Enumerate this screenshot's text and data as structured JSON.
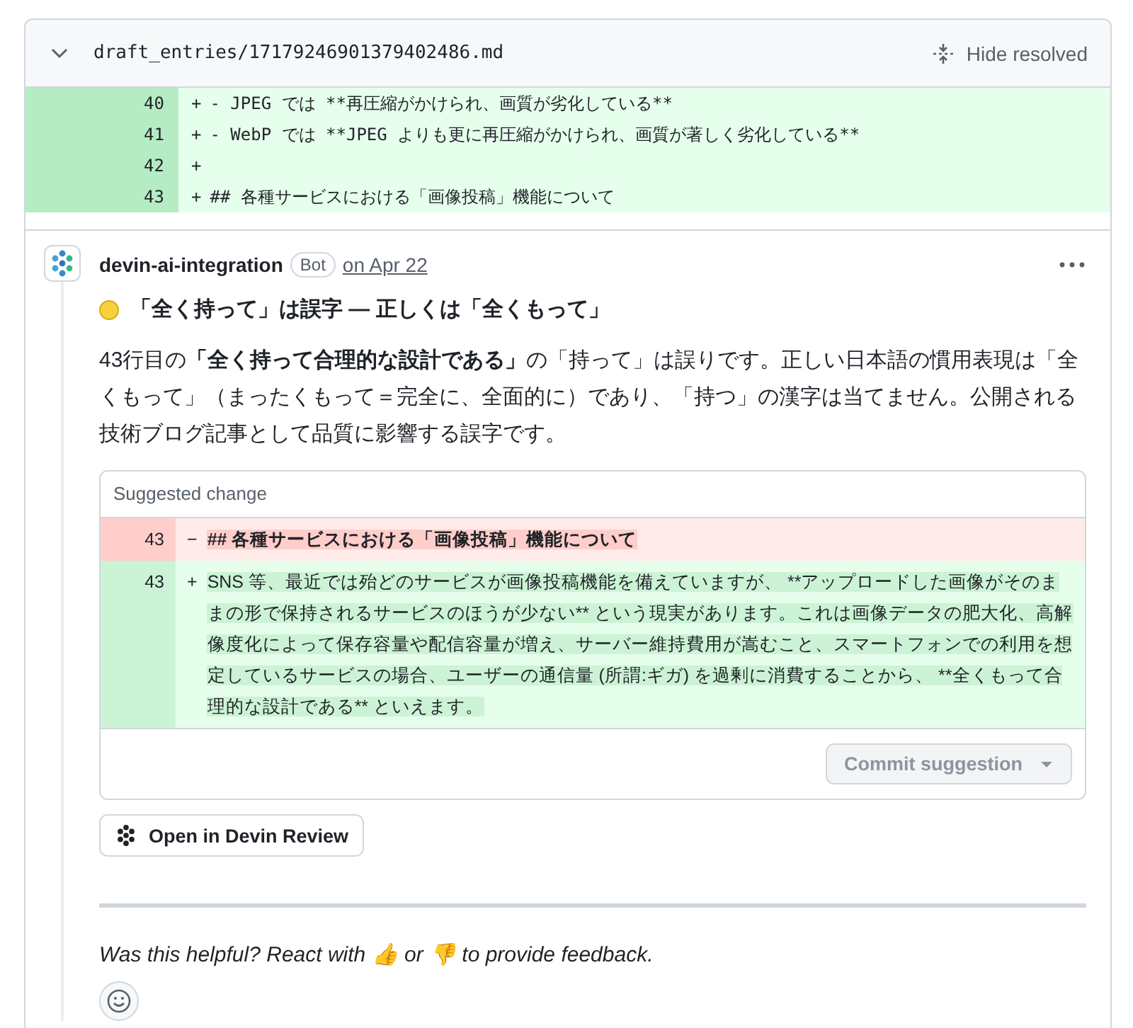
{
  "file_header": {
    "expanded": true,
    "path": "draft_entries/17179246901379402486.md",
    "hide_resolved": "Hide resolved"
  },
  "diff_lines": [
    {
      "number": "40",
      "marker": "+",
      "text": "- JPEG では **再圧縮がかけられ、画質が劣化している**"
    },
    {
      "number": "41",
      "marker": "+",
      "text": "- WebP では **JPEG よりも更に再圧縮がかけられ、画質が著しく劣化している**"
    },
    {
      "number": "42",
      "marker": "+"
    },
    {
      "number": "43",
      "marker": "+",
      "text": "## 各種サービスにおける「画像投稿」機能について"
    }
  ],
  "comment": {
    "author": "devin-ai-integration",
    "badge": "Bot",
    "date": "on Apr 22",
    "title": "「全く持って」は誤字 — 正しくは「全くもって」",
    "body": "43行目の**「全く持って合理的な設計である」**の「持って」は誤りです。正しい日本語の慣用表現は「全くもって」（まったくもって＝完全に、全面的に）であり、「持つ」の漢字は当てません。公開される技術ブログ記事として品質に影響する誤字です。"
  },
  "suggestion": {
    "header": "Suggested change",
    "lines": [
      {
        "kind": "deleted",
        "number": "43",
        "marker": "−",
        "text": "## 各種サービスにおける「画像投稿」機能について"
      },
      {
        "kind": "added",
        "number": "43",
        "marker": "+",
        "text": "SNS 等、最近では殆どのサービスが画像投稿機能を備えていますが、 **アップロードした画像がそのままの形で保持されるサービスのほうが少ない** という現実があります。これは画像データの肥大化、高解像度化によって保存容量や配信容量が増え、サーバー維持費用が嵩むこと、スマートフォンでの利用を想定しているサービスの場合、ユーザーの通信量 (所謂:ギガ) を過剰に消費することから、 **全くもって合理的な設計である** といえます。"
      }
    ],
    "commit_button": {
      "label": "Commit suggestion",
      "disabled": true
    }
  },
  "open_button": "Open in Devin Review",
  "feedback": "Was this helpful? React with 👍 or 👎 to provide feedback."
}
